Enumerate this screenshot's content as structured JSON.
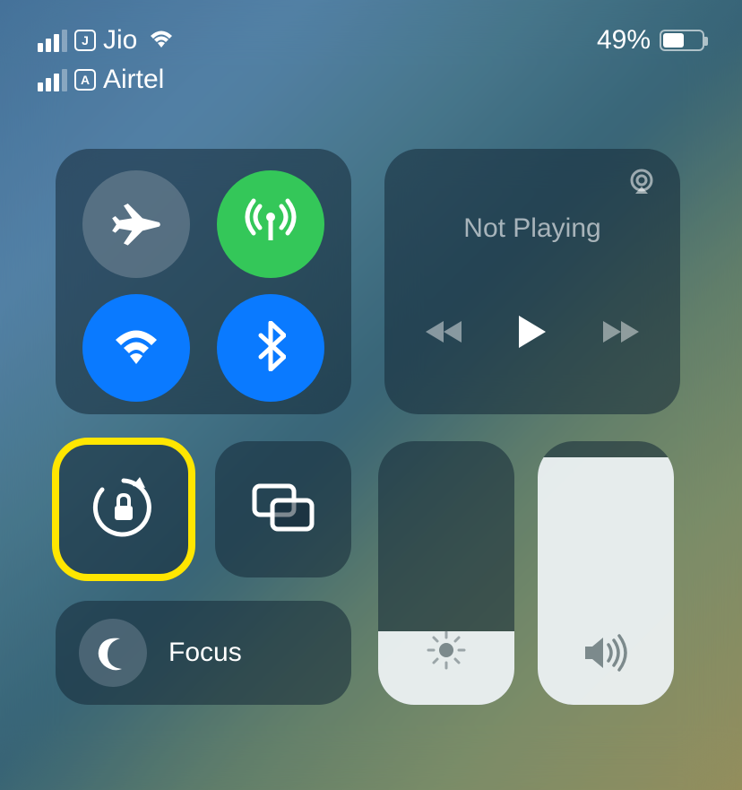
{
  "status": {
    "carrier1": {
      "sim_letter": "J",
      "name": "Jio",
      "signal_strength": 3,
      "wifi": true
    },
    "carrier2": {
      "sim_letter": "A",
      "name": "Airtel",
      "signal_strength": 3
    },
    "battery_pct": "49%",
    "battery_fill_pct": 49
  },
  "connectivity": {
    "airplane": {
      "active": false
    },
    "cellular": {
      "active": true
    },
    "wifi": {
      "active": true
    },
    "bluetooth": {
      "active": true
    }
  },
  "media": {
    "title": "Not Playing"
  },
  "tiles": {
    "orientation_lock_highlighted": true,
    "focus_label": "Focus"
  },
  "sliders": {
    "brightness_pct": 28,
    "volume_pct": 94
  }
}
